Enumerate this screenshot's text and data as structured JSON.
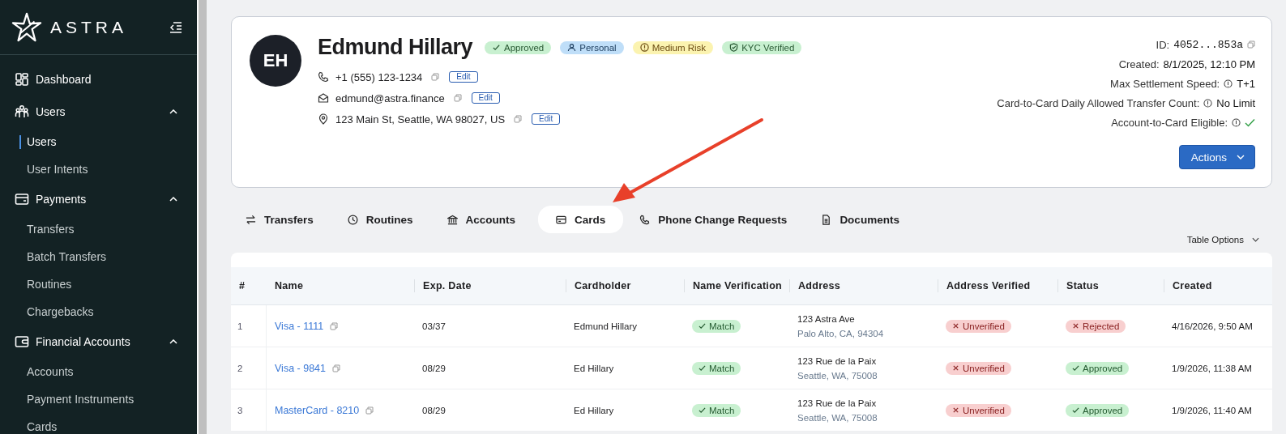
{
  "sidebar": {
    "logo": "ASTRA",
    "items": [
      {
        "label": "Dashboard"
      },
      {
        "label": "Users",
        "expanded": true,
        "children": [
          {
            "label": "Users",
            "selected": true
          },
          {
            "label": "User Intents",
            "selected": false
          }
        ]
      },
      {
        "label": "Payments",
        "expanded": true,
        "children": [
          {
            "label": "Transfers",
            "selected": false
          },
          {
            "label": "Batch Transfers",
            "selected": false
          },
          {
            "label": "Routines",
            "selected": false
          },
          {
            "label": "Chargebacks",
            "selected": false
          }
        ]
      },
      {
        "label": "Financial Accounts",
        "expanded": true,
        "children": [
          {
            "label": "Accounts",
            "selected": false
          },
          {
            "label": "Payment Instruments",
            "selected": false
          },
          {
            "label": "Cards",
            "selected": false
          }
        ]
      }
    ]
  },
  "profile": {
    "initials": "EH",
    "name": "Edmund Hillary",
    "badges": [
      {
        "label": "Approved",
        "kind": "approved"
      },
      {
        "label": "Personal",
        "kind": "personal"
      },
      {
        "label": "Medium Risk",
        "kind": "risk"
      },
      {
        "label": "KYC Verified",
        "kind": "kyc"
      }
    ],
    "contacts": [
      {
        "kind": "phone",
        "value": "+1 (555) 123-1234",
        "action": "Edit"
      },
      {
        "kind": "email",
        "value": "edmund@astra.finance",
        "action": "Edit"
      },
      {
        "kind": "address",
        "value": "123 Main St, Seattle, WA 98027, US",
        "action": "Edit"
      }
    ],
    "details": [
      {
        "label": "ID:",
        "value": "4052...853a",
        "kind": "id"
      },
      {
        "label": "Created:",
        "value": "8/1/2025, 12:10 PM",
        "kind": "text"
      },
      {
        "label": "Max Settlement Speed:",
        "value": "T+1",
        "kind": "info"
      },
      {
        "label": "Card-to-Card Daily Allowed Transfer Count:",
        "value": "No Limit",
        "kind": "info"
      },
      {
        "label": "Account-to-Card Eligible:",
        "kind": "check"
      }
    ],
    "actions": "Actions"
  },
  "tabs": [
    {
      "label": "Transfers",
      "selected": false
    },
    {
      "label": "Routines",
      "selected": false
    },
    {
      "label": "Accounts",
      "selected": false
    },
    {
      "label": "Cards",
      "selected": true
    },
    {
      "label": "Phone Change Requests",
      "selected": false
    },
    {
      "label": "Documents",
      "selected": false
    }
  ],
  "table_options": "Table Options",
  "table": {
    "columns": [
      "#",
      "Name",
      "Exp. Date",
      "Cardholder",
      "Name Verification",
      "Address",
      "Address Verified",
      "Status",
      "Created"
    ],
    "rows": [
      {
        "index": "1",
        "name": "Visa - 1111",
        "exp": "03/37",
        "cardholder": "Edmund Hillary",
        "name_verification": {
          "label": "Match",
          "kind": "ok"
        },
        "address_line1": "123 Astra Ave",
        "address_line2": "Palo Alto, CA, 94304",
        "address_verified": {
          "label": "Unverified",
          "kind": "bad"
        },
        "status": {
          "label": "Rejected",
          "kind": "bad"
        },
        "created": "4/16/2026, 9:50 AM"
      },
      {
        "index": "2",
        "name": "Visa - 9841",
        "exp": "08/29",
        "cardholder": "Ed Hillary",
        "name_verification": {
          "label": "Match",
          "kind": "ok"
        },
        "address_line1": "123 Rue de la Paix",
        "address_line2": "Seattle, WA, 75008",
        "address_verified": {
          "label": "Unverified",
          "kind": "bad"
        },
        "status": {
          "label": "Approved",
          "kind": "ok"
        },
        "created": "1/9/2026, 11:38 AM"
      },
      {
        "index": "3",
        "name": "MasterCard - 8210",
        "exp": "08/29",
        "cardholder": "Ed Hillary",
        "name_verification": {
          "label": "Match",
          "kind": "ok"
        },
        "address_line1": "123 Rue de la Paix",
        "address_line2": "Seattle, WA, 75008",
        "address_verified": {
          "label": "Unverified",
          "kind": "bad"
        },
        "status": {
          "label": "Approved",
          "kind": "ok"
        },
        "created": "1/9/2026, 11:40 AM"
      }
    ]
  }
}
